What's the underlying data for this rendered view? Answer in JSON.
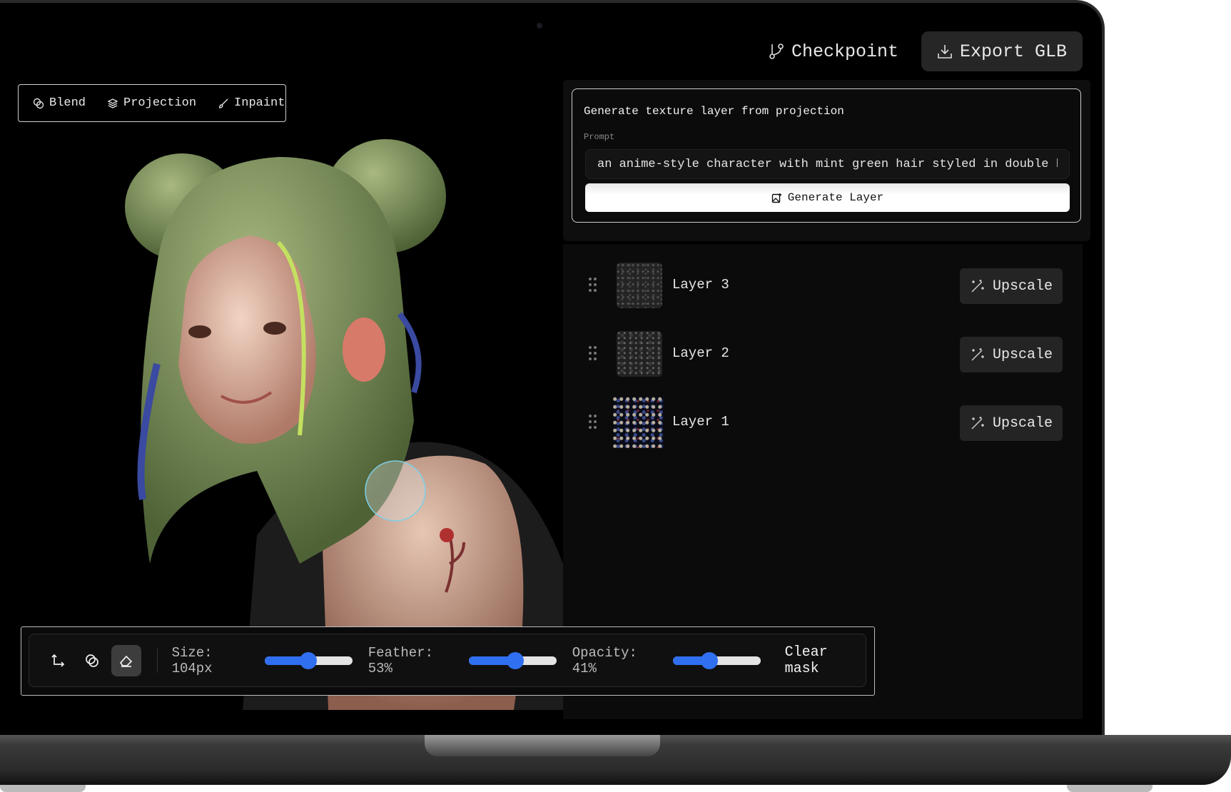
{
  "modes": [
    {
      "label": "Blend",
      "icon": "blend-icon"
    },
    {
      "label": "Projection",
      "icon": "layers-icon"
    },
    {
      "label": "Inpaint",
      "icon": "brush-icon"
    }
  ],
  "header": {
    "checkpoint_label": "Checkpoint",
    "export_label": "Export GLB"
  },
  "generate": {
    "title": "Generate texture layer from projection",
    "prompt_label": "Prompt",
    "prompt_value": "an anime-style character with mint green hair styled in double buns",
    "button_label": "Generate Layer"
  },
  "layers": [
    {
      "name": "Layer 3",
      "action": "Upscale"
    },
    {
      "name": "Layer 2",
      "action": "Upscale"
    },
    {
      "name": "Layer 1",
      "action": "Upscale"
    }
  ],
  "toolbar": {
    "size_label": "Size: 104px",
    "size_slider": 0.5,
    "feather_label": "Feather: 53%",
    "feather_slider": 0.53,
    "opacity_label": "Opacity: 41%",
    "opacity_slider": 0.42,
    "clear_label": "Clear mask",
    "active_tool": "eraser"
  },
  "colors": {
    "accent": "#2f6ff0",
    "background": "#000000",
    "panel": "#0b0b0b"
  }
}
